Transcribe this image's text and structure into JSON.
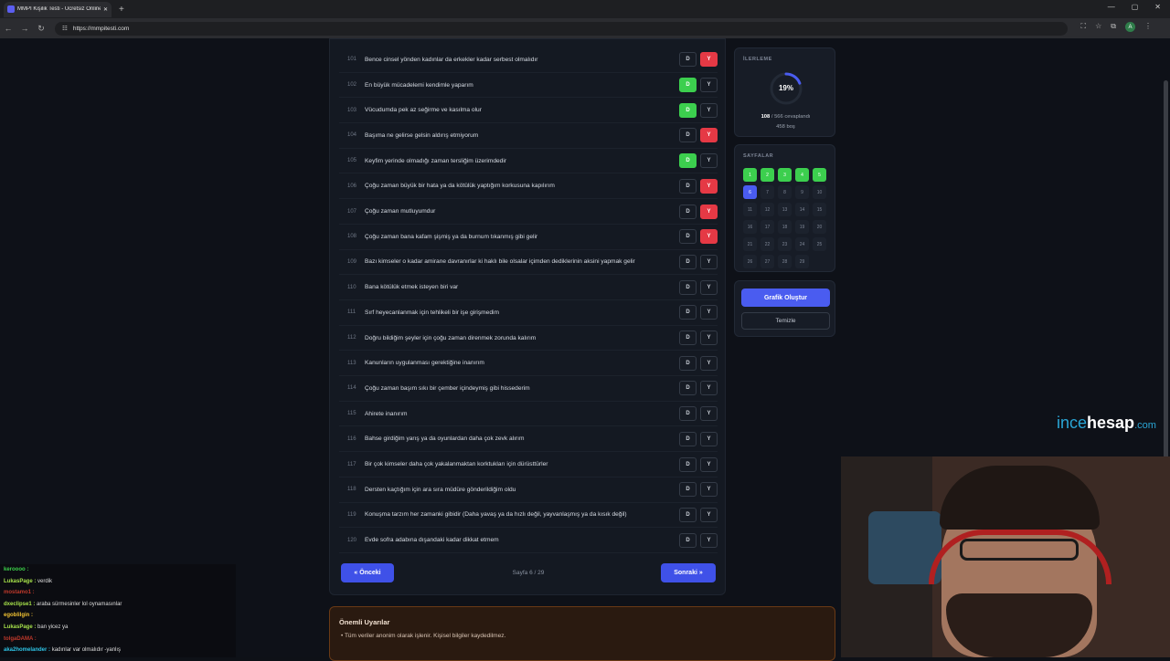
{
  "browser": {
    "tab_title": "MMPI Kişilik Testi - Ücretsiz Online...",
    "url": "https://mmpitesti.com",
    "avatar_letter": "A"
  },
  "questions": [
    {
      "num": "101",
      "text": "Bence cinsel yönden kadınlar da erkekler kadar serbest olmalıdır",
      "answer": "Y"
    },
    {
      "num": "102",
      "text": "En büyük mücadelemi kendimle yaparım",
      "answer": "D"
    },
    {
      "num": "103",
      "text": "Vücudumda pek az seğirme ve kasılma olur",
      "answer": "D"
    },
    {
      "num": "104",
      "text": "Başıma ne gelirse gelsin aldırış etmiyorum",
      "answer": "Y"
    },
    {
      "num": "105",
      "text": "Keyfim yerinde olmadığı zaman tersliğim üzerimdedir",
      "answer": "D"
    },
    {
      "num": "106",
      "text": "Çoğu zaman büyük bir hata ya da kötülük yaptığım korkusuna kapılırım",
      "answer": "Y"
    },
    {
      "num": "107",
      "text": "Çoğu zaman mutluyumdur",
      "answer": "Y"
    },
    {
      "num": "108",
      "text": "Çoğu zaman bana kafam şişmiş ya da burnum tıkanmış gibi gelir",
      "answer": "Y"
    },
    {
      "num": "109",
      "text": "Bazı kimseler o kadar amirane davranırlar ki haklı bile olsalar içimden dediklerinin aksini yapmak gelir",
      "answer": ""
    },
    {
      "num": "110",
      "text": "Bana kötülük etmek isteyen biri var",
      "answer": ""
    },
    {
      "num": "111",
      "text": "Sırf heyecanlanmak için tehlikeli bir işe girişmedim",
      "answer": ""
    },
    {
      "num": "112",
      "text": "Doğru bildiğim şeyler için çoğu zaman direnmek zorunda kalırım",
      "answer": ""
    },
    {
      "num": "113",
      "text": "Kanunların uygulanması gerektiğine inanırım",
      "answer": ""
    },
    {
      "num": "114",
      "text": "Çoğu zaman başım sıkı bir çember içindeymiş gibi hissederim",
      "answer": ""
    },
    {
      "num": "115",
      "text": "Ahirete inanırım",
      "answer": ""
    },
    {
      "num": "116",
      "text": "Bahse girdiğim yarış ya da oyunlardan daha çok zevk alırım",
      "answer": ""
    },
    {
      "num": "117",
      "text": "Bir çok kimseler daha çok yakalanmaktan korktukları için dürüsttürler",
      "answer": ""
    },
    {
      "num": "118",
      "text": "Dersten kaçtığım için ara sıra müdüre gönderildiğim oldu",
      "answer": ""
    },
    {
      "num": "119",
      "text": "Konuşma tarzım her zamanki gibidir (Daha yavaş ya da hızlı değil, yayvanlaşmış ya da kısık değil)",
      "answer": ""
    },
    {
      "num": "120",
      "text": "Evde sofra adabına dışandaki kadar dikkat etmem",
      "answer": ""
    }
  ],
  "labels": {
    "yes": "D",
    "no": "Y"
  },
  "pager": {
    "prev": "« Önceki",
    "info": "Sayfa 6 / 29",
    "next": "Sonraki »"
  },
  "progress": {
    "title": "İLERLEME",
    "percent_text": "19%",
    "percent": 0.19,
    "answered": "108",
    "answered_rest": " / 566 cevaplandı",
    "empty": "458 boş"
  },
  "pages": {
    "title": "SAYFALAR",
    "items": [
      {
        "n": "1",
        "state": "done"
      },
      {
        "n": "2",
        "state": "done"
      },
      {
        "n": "3",
        "state": "done"
      },
      {
        "n": "4",
        "state": "done"
      },
      {
        "n": "5",
        "state": "done"
      },
      {
        "n": "6",
        "state": "cur"
      },
      {
        "n": "7",
        "state": ""
      },
      {
        "n": "8",
        "state": ""
      },
      {
        "n": "9",
        "state": ""
      },
      {
        "n": "10",
        "state": ""
      },
      {
        "n": "11",
        "state": ""
      },
      {
        "n": "12",
        "state": ""
      },
      {
        "n": "13",
        "state": ""
      },
      {
        "n": "14",
        "state": ""
      },
      {
        "n": "15",
        "state": ""
      },
      {
        "n": "16",
        "state": ""
      },
      {
        "n": "17",
        "state": ""
      },
      {
        "n": "18",
        "state": ""
      },
      {
        "n": "19",
        "state": ""
      },
      {
        "n": "20",
        "state": ""
      },
      {
        "n": "21",
        "state": ""
      },
      {
        "n": "22",
        "state": ""
      },
      {
        "n": "23",
        "state": ""
      },
      {
        "n": "24",
        "state": ""
      },
      {
        "n": "25",
        "state": ""
      },
      {
        "n": "26",
        "state": ""
      },
      {
        "n": "27",
        "state": ""
      },
      {
        "n": "28",
        "state": ""
      },
      {
        "n": "29",
        "state": ""
      }
    ]
  },
  "actions": {
    "graph": "Grafik Oluştur",
    "clear": "Temizle"
  },
  "warning": {
    "title": "Önemli Uyarılar",
    "item": "• Tüm veriler anonim olarak işlenir. Kişisel bilgiler kaydedilmez."
  },
  "watermark": {
    "a": "ince",
    "b": "hesap",
    "c": ".com"
  },
  "chat": [
    {
      "user": "keroooo :",
      "msg": "",
      "color": "#3cd24a"
    },
    {
      "user": "LukasPage :",
      "msg": " verdik",
      "color": "#a6e14a"
    },
    {
      "user": "mostamo1 :",
      "msg": "",
      "color": "#c0392b"
    },
    {
      "user": "dxeclipse1 :",
      "msg": " araba sürmesinler lol oynamasınlar",
      "color": "#a6e14a"
    },
    {
      "user": "egoblilgin :",
      "msg": "",
      "color": "#f1c232"
    },
    {
      "user": "LukasPage :",
      "msg": " ban yicez ya",
      "color": "#a6e14a"
    },
    {
      "user": "tolgaDAMA :",
      "msg": "",
      "color": "#c0392b"
    },
    {
      "user": "aka2homelander :",
      "msg": " kadınlar var olmalıdır -yanlış",
      "color": "#2ec4e6"
    }
  ],
  "colors": {
    "accent": "#4a5cf0",
    "yes_active": "#3ccf4e",
    "no_active": "#e53945"
  }
}
